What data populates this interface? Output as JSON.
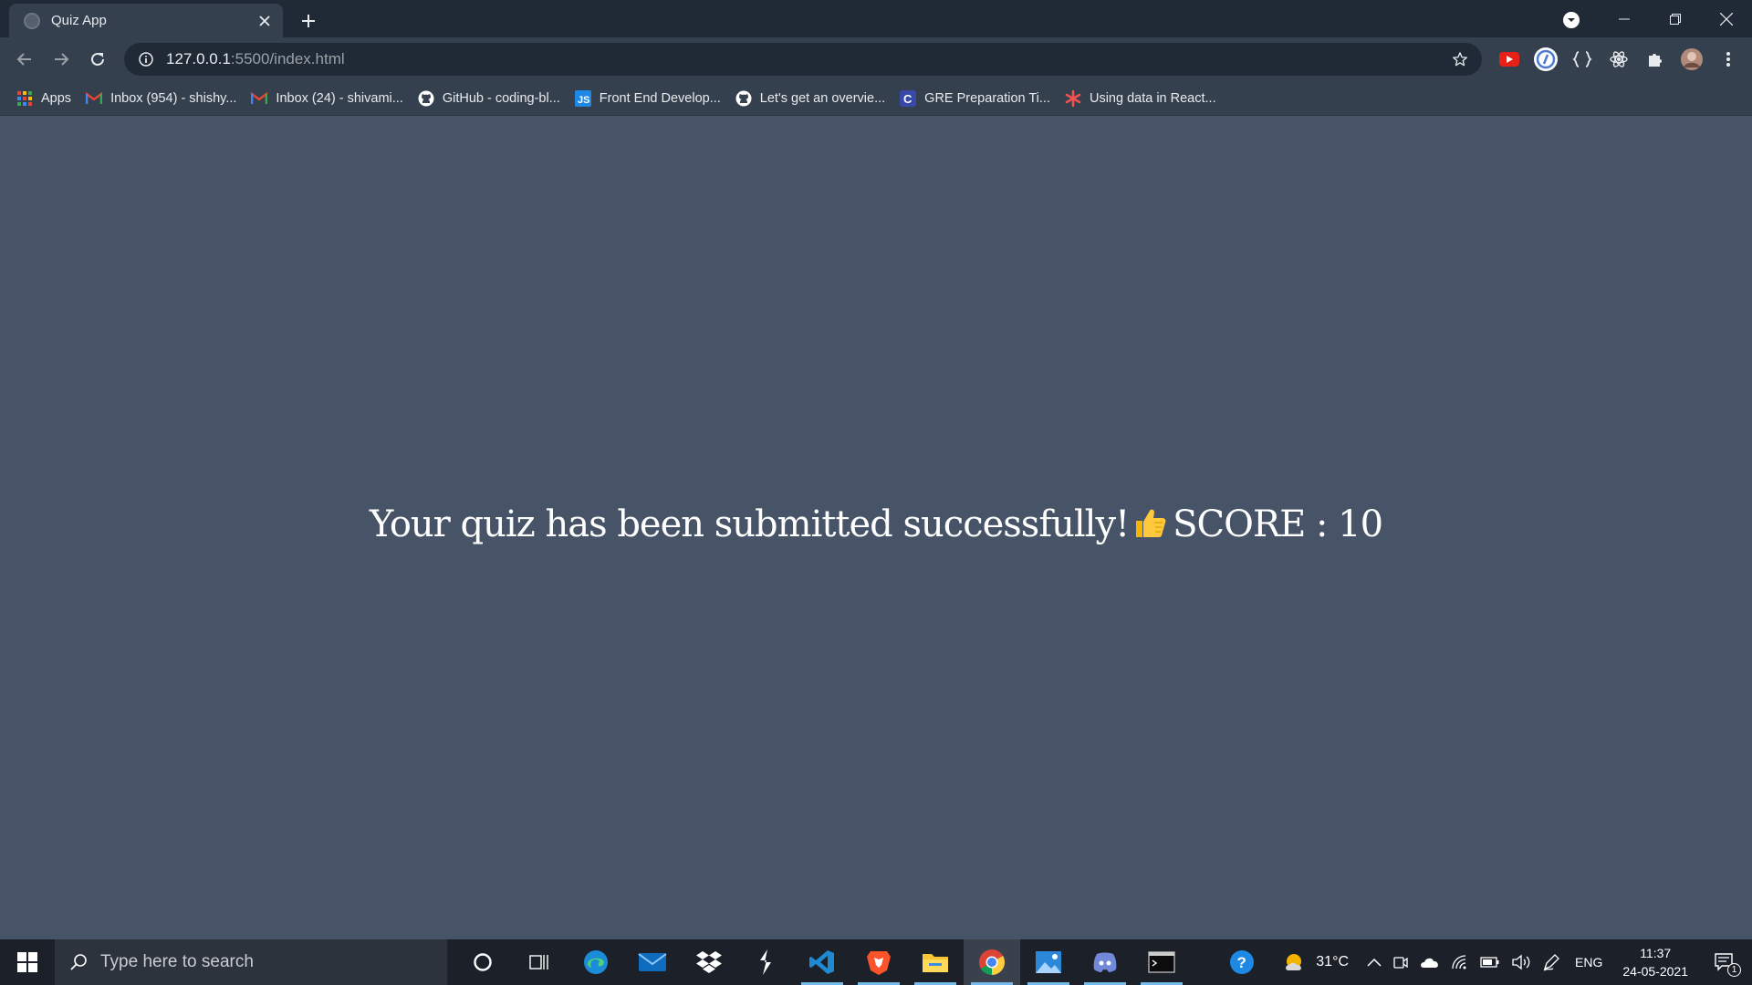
{
  "browser": {
    "tab": {
      "title": "Quiz App"
    },
    "address": {
      "host": "127.0.0.1",
      "path": ":5500/index.html"
    },
    "bookmarks": [
      {
        "label": "Apps",
        "icon": "apps-grid-icon"
      },
      {
        "label": "Inbox (954) - shishy...",
        "icon": "gmail-icon"
      },
      {
        "label": "Inbox (24) - shivami...",
        "icon": "gmail-icon"
      },
      {
        "label": "GitHub - coding-bl...",
        "icon": "github-icon"
      },
      {
        "label": "Front End Develop...",
        "icon": "js-icon"
      },
      {
        "label": "Let's get an overvie...",
        "icon": "github-icon"
      },
      {
        "label": "GRE Preparation Ti...",
        "icon": "c-icon"
      },
      {
        "label": "Using data in React...",
        "icon": "asterisk-icon"
      }
    ]
  },
  "page": {
    "message": "Your quiz has been submitted successfully!",
    "score_label": "SCORE : 10"
  },
  "taskbar": {
    "search_placeholder": "Type here to search",
    "temperature": "31°C",
    "language": "ENG",
    "time": "11:37",
    "date": "24-05-2021",
    "notification_count": "1"
  },
  "colors": {
    "page_bg": "#475467",
    "browser_frame": "#202a36",
    "toolbar": "#35404e"
  }
}
